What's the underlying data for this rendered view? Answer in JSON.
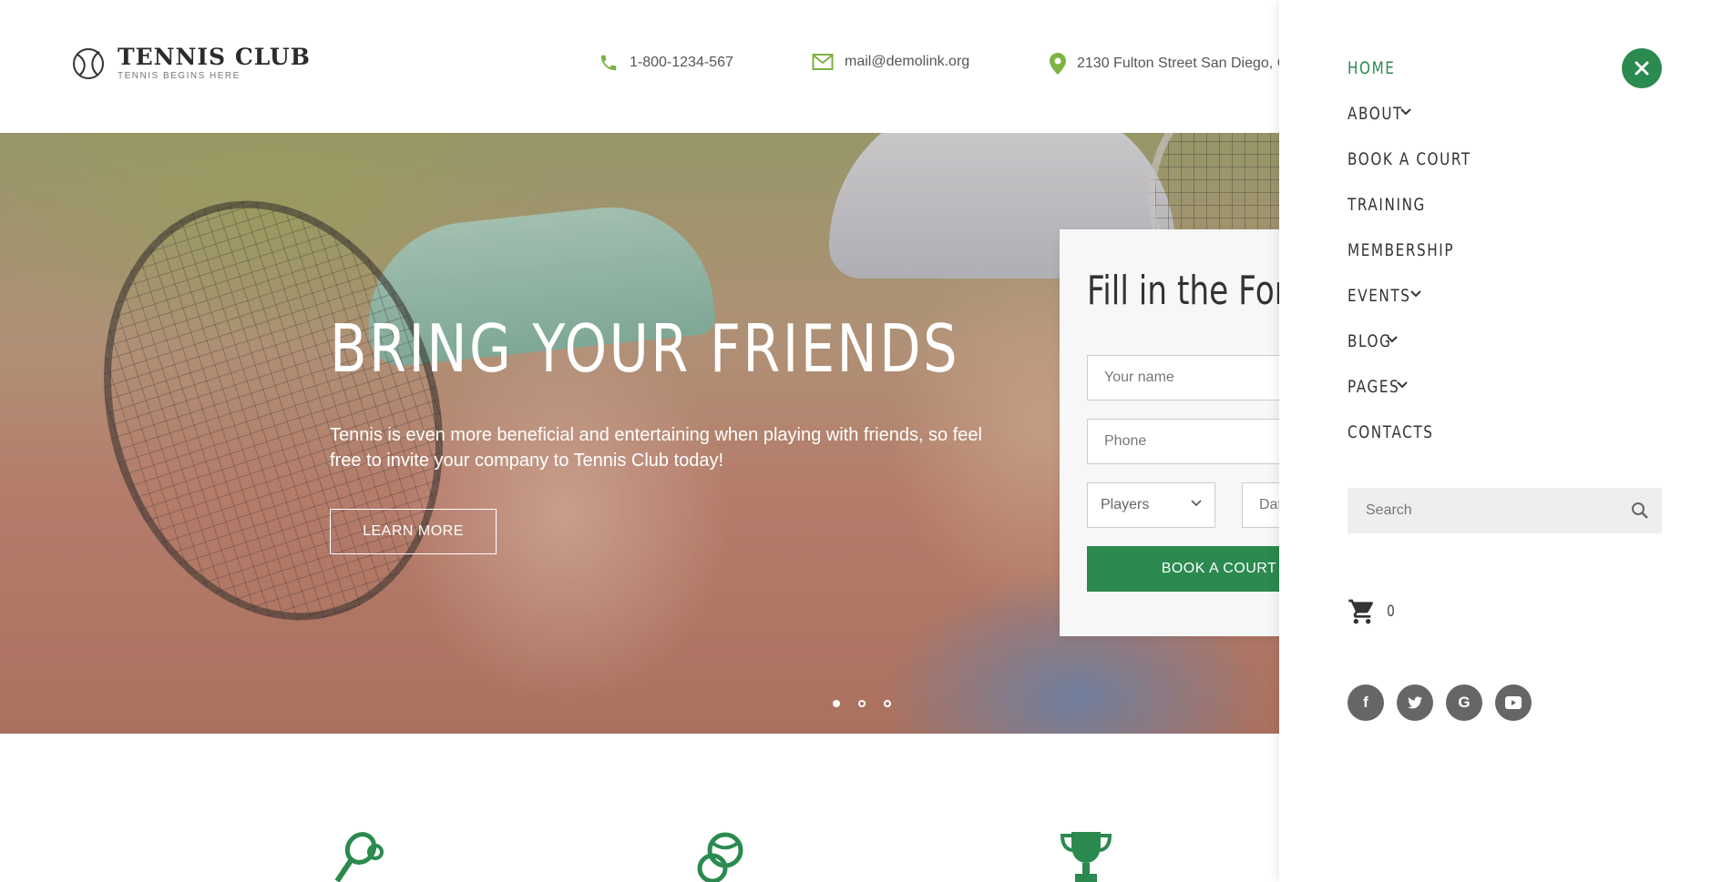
{
  "brand": {
    "title": "TENNIS CLUB",
    "tagline": "TENNIS BEGINS HERE",
    "accent_color": "#2a8a4f"
  },
  "contacts": {
    "phone": "1-800-1234-567",
    "email": "mail@demolink.org",
    "address": "2130 Fulton Street San Diego, C"
  },
  "hero": {
    "title": "BRING YOUR FRIENDS",
    "text": "Tennis is even more beneficial and entertaining when playing with friends, so feel free to invite your company to Tennis Club today!",
    "button_label": "LEARN MORE",
    "slides": 3,
    "active_slide": 1
  },
  "form": {
    "title": "Fill in the Form",
    "name_placeholder": "Your name",
    "phone_placeholder": "Phone",
    "players_selected": "Players",
    "date_placeholder": "Dat",
    "submit_label": "BOOK A COURT"
  },
  "features": {
    "icons": [
      "tennis-racket-icon",
      "tennis-balls-icon",
      "trophy-icon"
    ]
  },
  "menu": {
    "items": [
      {
        "label": "HOME",
        "active": true,
        "has_dropdown": false
      },
      {
        "label": "ABOUT",
        "active": false,
        "has_dropdown": true
      },
      {
        "label": "BOOK A COURT",
        "active": false,
        "has_dropdown": false
      },
      {
        "label": "TRAINING",
        "active": false,
        "has_dropdown": false
      },
      {
        "label": "MEMBERSHIP",
        "active": false,
        "has_dropdown": false
      },
      {
        "label": "EVENTS",
        "active": false,
        "has_dropdown": true
      },
      {
        "label": "BLOG",
        "active": false,
        "has_dropdown": true
      },
      {
        "label": "PAGES",
        "active": false,
        "has_dropdown": true
      },
      {
        "label": "CONTACTS",
        "active": false,
        "has_dropdown": false
      }
    ],
    "search_placeholder": "Search",
    "cart_count": "0",
    "socials": [
      {
        "icon": "facebook-icon",
        "glyph": "f"
      },
      {
        "icon": "twitter-icon",
        "glyph": ""
      },
      {
        "icon": "google-icon",
        "glyph": "G"
      },
      {
        "icon": "youtube-icon",
        "glyph": ""
      }
    ]
  }
}
